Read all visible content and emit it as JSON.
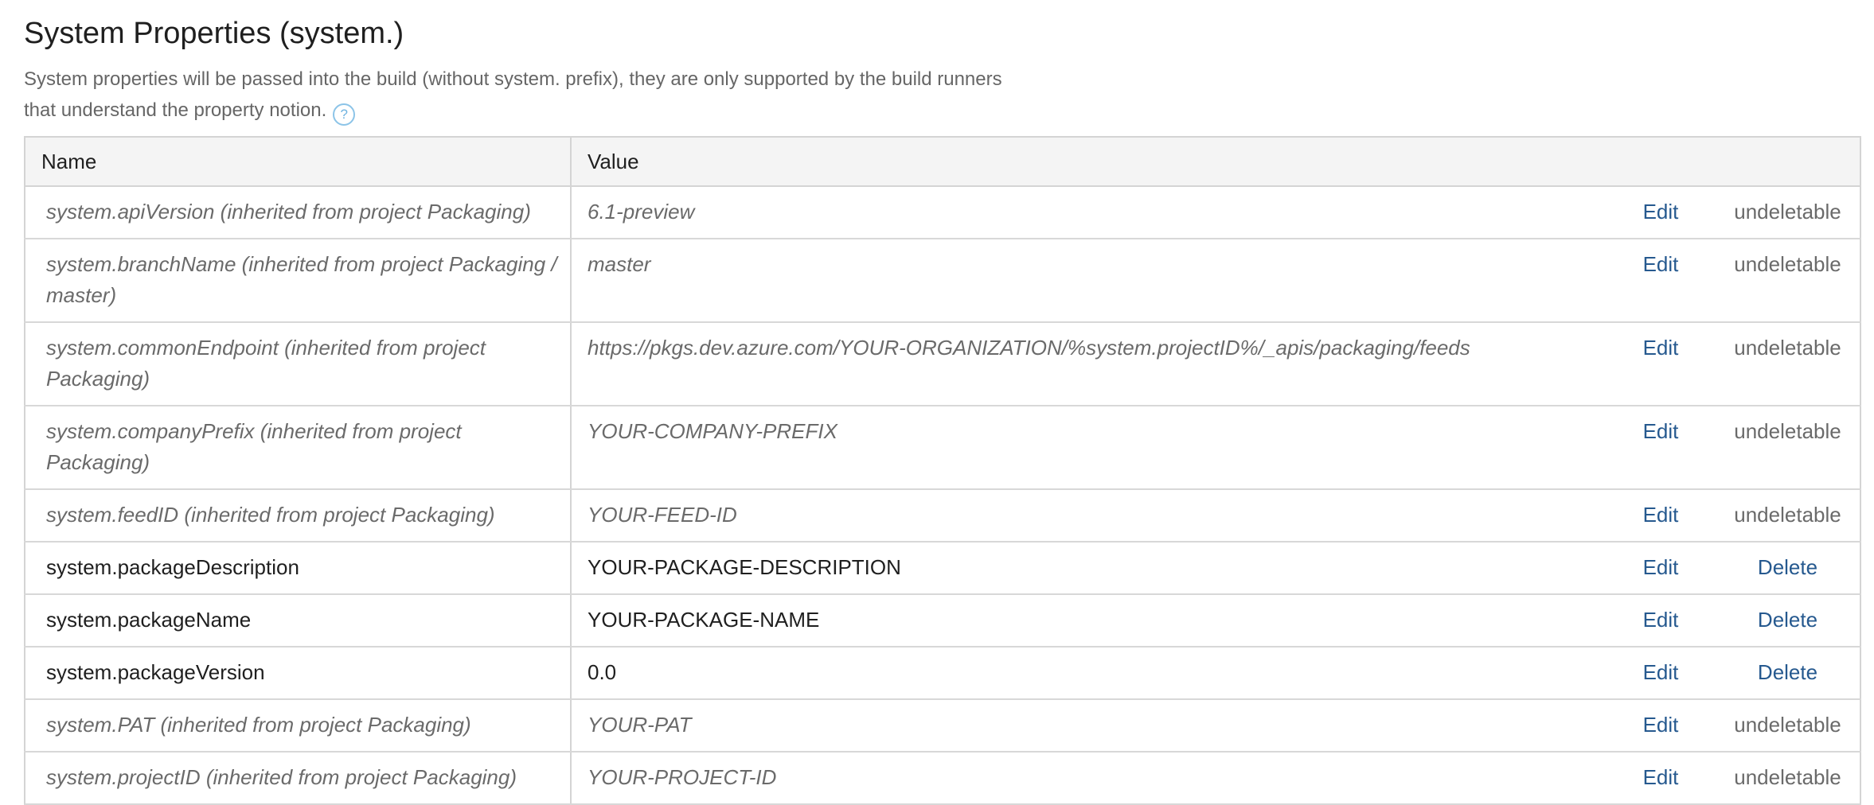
{
  "section": {
    "title": "System Properties (system.)",
    "description": "System properties will be passed into the build (without system. prefix), they are only supported by the build runners that understand the property notion.",
    "help_icon": "question-circle-icon",
    "colors": {
      "link": "#26598f",
      "muted_text": "#6a6a6a",
      "header_bg": "#f4f4f4",
      "help_icon": "#6fb3e0"
    }
  },
  "table": {
    "columns": [
      "Name",
      "Value"
    ],
    "rows": [
      {
        "name": "system.apiVersion (inherited from project Packaging)",
        "value": "6.1-preview",
        "edit": "Edit",
        "delete": "undeletable",
        "inherited": true
      },
      {
        "name": "system.branchName (inherited from project Packaging / master)",
        "value": "master",
        "edit": "Edit",
        "delete": "undeletable",
        "inherited": true
      },
      {
        "name": "system.commonEndpoint (inherited from project Packaging)",
        "value": "https://pkgs.dev.azure.com/YOUR-ORGANIZATION/%system.projectID%/_apis/packaging/feeds",
        "edit": "Edit",
        "delete": "undeletable",
        "inherited": true
      },
      {
        "name": "system.companyPrefix (inherited from project Packaging)",
        "value": "YOUR-COMPANY-PREFIX",
        "edit": "Edit",
        "delete": "undeletable",
        "inherited": true
      },
      {
        "name": "system.feedID (inherited from project Packaging)",
        "value": "YOUR-FEED-ID",
        "edit": "Edit",
        "delete": "undeletable",
        "inherited": true
      },
      {
        "name": "system.packageDescription",
        "value": "YOUR-PACKAGE-DESCRIPTION",
        "edit": "Edit",
        "delete": "Delete",
        "inherited": false
      },
      {
        "name": "system.packageName",
        "value": "YOUR-PACKAGE-NAME",
        "edit": "Edit",
        "delete": "Delete",
        "inherited": false
      },
      {
        "name": "system.packageVersion",
        "value": "0.0",
        "edit": "Edit",
        "delete": "Delete",
        "inherited": false
      },
      {
        "name": "system.PAT (inherited from project Packaging)",
        "value": "YOUR-PAT",
        "edit": "Edit",
        "delete": "undeletable",
        "inherited": true
      },
      {
        "name": "system.projectID (inherited from project Packaging)",
        "value": "YOUR-PROJECT-ID",
        "edit": "Edit",
        "delete": "undeletable",
        "inherited": true
      }
    ]
  }
}
